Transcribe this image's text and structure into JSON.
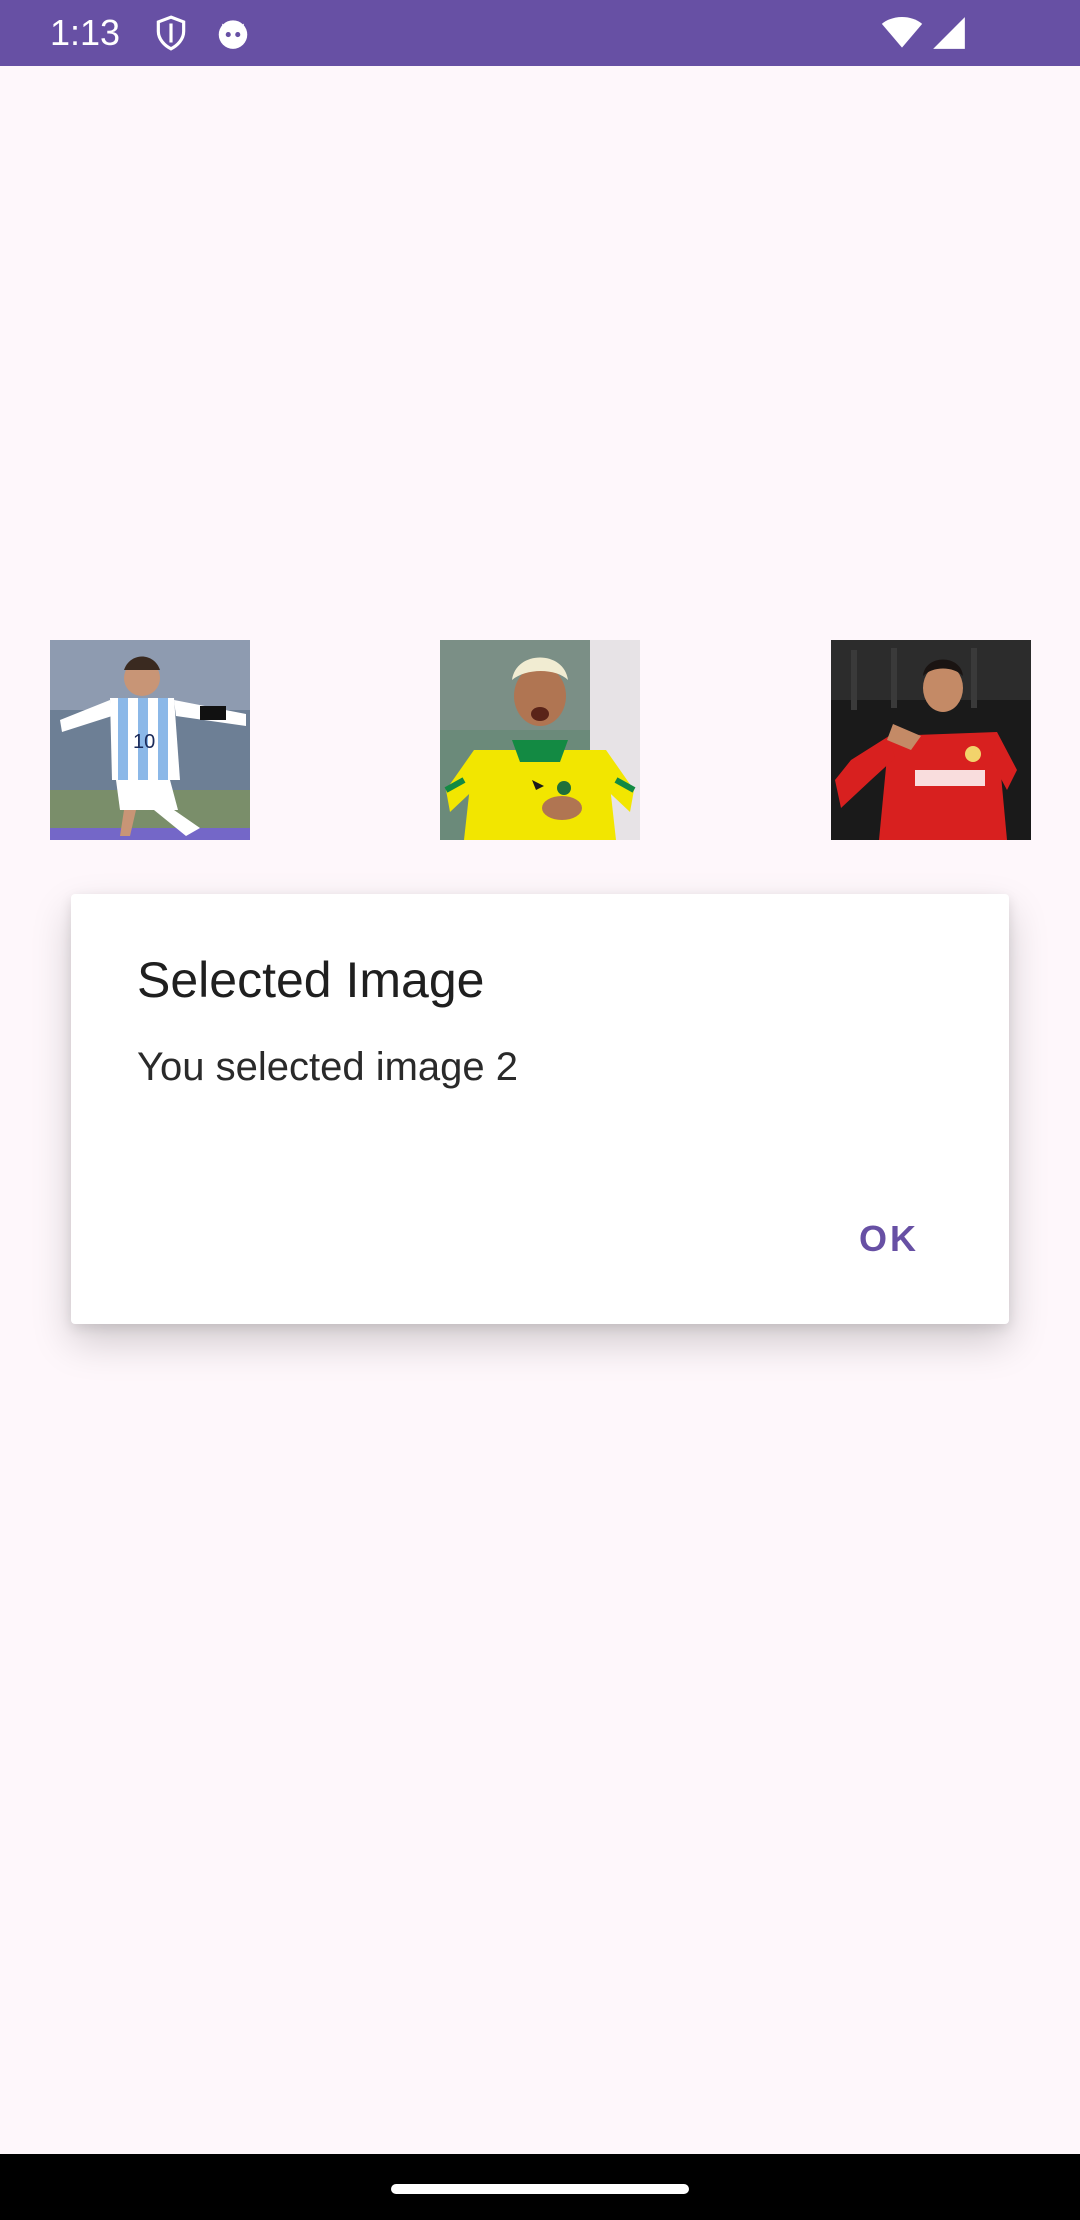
{
  "status_bar": {
    "time": "1:13",
    "icons": [
      "shield-icon",
      "cat-icon",
      "wifi-icon",
      "signal-icon"
    ],
    "color": "#6750a4"
  },
  "images": [
    {
      "name": "image-1",
      "colors": [
        "#8bb8e8",
        "#ffffff"
      ]
    },
    {
      "name": "image-2",
      "colors": [
        "#f2e600",
        "#138a43"
      ]
    },
    {
      "name": "image-3",
      "colors": [
        "#d8201f",
        "#1a1a1a"
      ]
    }
  ],
  "dialog": {
    "title": "Selected Image",
    "message": "You selected image 2",
    "ok_label": "OK",
    "accent": "#6750a4"
  },
  "nav_bar": {
    "handle_color": "#ffffff",
    "background": "#000000"
  }
}
